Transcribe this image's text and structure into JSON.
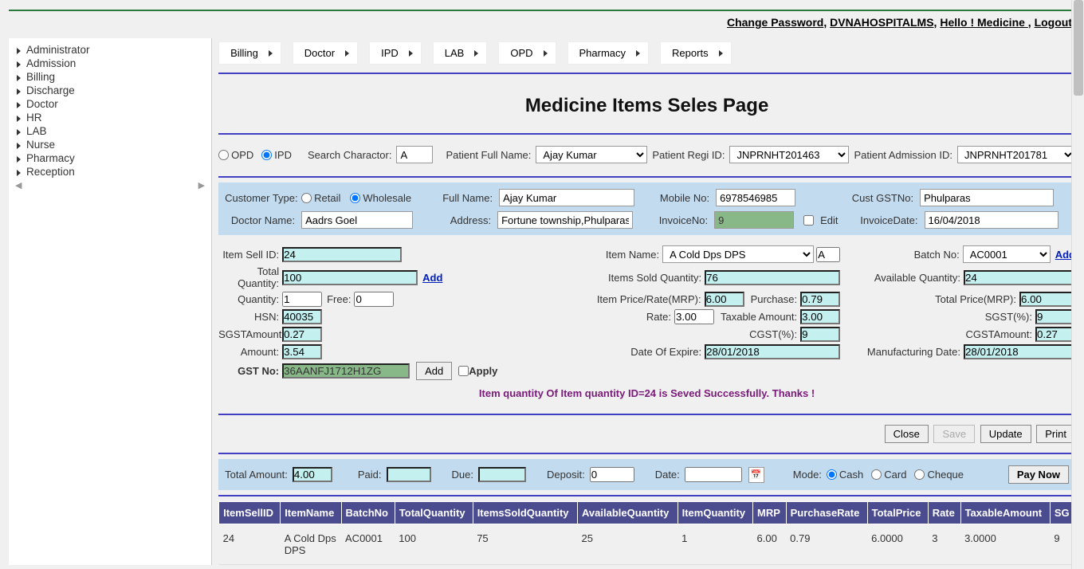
{
  "header": {
    "links": [
      "Change Password",
      "DVNAHOSPITALMS",
      "Hello ! Medicine ",
      "Logout"
    ]
  },
  "sidebar": {
    "items": [
      "Administrator",
      "Admission",
      "Billing",
      "Discharge",
      "Doctor",
      "HR",
      "LAB",
      "Nurse",
      "Pharmacy",
      "Reception"
    ]
  },
  "topmenu": {
    "items": [
      "Billing",
      "Doctor",
      "IPD",
      "LAB",
      "OPD",
      "Pharmacy",
      "Reports"
    ]
  },
  "page_title": "Medicine Items Seles Page",
  "search": {
    "opd_label": "OPD",
    "ipd_label": "IPD",
    "ipd_selected": true,
    "search_char_label": "Search Charactor:",
    "search_char": "A",
    "full_name_label": "Patient Full Name:",
    "full_name": "Ajay Kumar",
    "regi_label": "Patient Regi ID:",
    "regi_id": "JNPRNHT201463",
    "admission_label": "Patient Admission ID:",
    "admission_id": "JNPRNHT201781"
  },
  "customer": {
    "type_label": "Customer Type:",
    "retail": "Retail",
    "wholesale": "Wholesale",
    "wholesale_selected": true,
    "full_name_label": "Full Name:",
    "full_name": "Ajay Kumar",
    "mobile_label": "Mobile No:",
    "mobile": "6978546985",
    "cust_gst_label": "Cust GSTNo:",
    "cust_gst": "Phulparas",
    "doctor_label": "Doctor Name:",
    "doctor": "Aadrs Goel",
    "address_label": "Address:",
    "address": "Fortune township,Phulparas,",
    "invoice_no_label": "InvoiceNo:",
    "invoice_no": "9",
    "edit_label": "Edit",
    "invoice_date_label": "InvoiceDate:",
    "invoice_date": "16/04/2018"
  },
  "item": {
    "sell_id_label": "Item Sell ID:",
    "sell_id": "24",
    "item_name_label": "Item Name:",
    "item_name": "A Cold Dps DPS",
    "item_name_code": "A",
    "batch_label": "Batch No:",
    "batch": "AC0001",
    "add_label": "Add",
    "total_qty_label": "Total Quantity:",
    "total_qty": "100",
    "sold_qty_label": "Items Sold Quantity:",
    "sold_qty": "76",
    "avail_qty_label": "Available Quantity:",
    "avail_qty": "24",
    "qty_label": "Quantity:",
    "qty": "1",
    "free_label": "Free:",
    "free": "0",
    "mrp_label": "Item Price/Rate(MRP):",
    "mrp": "6.00",
    "purchase_label": "Purchase:",
    "purchase": "0.79",
    "total_price_label": "Total Price(MRP):",
    "total_price": "6.00",
    "hsn_label": "HSN:",
    "hsn": "40035",
    "rate_label": "Rate:",
    "rate": "3.00",
    "taxable_label": "Taxable Amount:",
    "taxable": "3.00",
    "sgst_pct_label": "SGST(%):",
    "sgst_pct": "9",
    "sgst_amt_label": "SGSTAmount:",
    "sgst_amt": "0.27",
    "cgst_pct_label": "CGST(%):",
    "cgst_pct": "9",
    "cgst_amt_label": "CGSTAmount:",
    "cgst_amt": "0.27",
    "amount_label": "Amount:",
    "amount": "3.54",
    "expire_label": "Date Of Expire:",
    "expire": "28/01/2018",
    "mfg_label": "Manufacturing Date:",
    "mfg": "28/01/2018",
    "gst_no_label": "GST No:",
    "gst_no": "36AANFJ1712H1ZG",
    "add_btn": "Add",
    "apply_label": "Apply"
  },
  "status_msg": "Item quantity Of Item quantity ID=24 is Seved Successfully. Thanks !",
  "buttons": {
    "close": "Close",
    "save": "Save",
    "update": "Update",
    "print": "Print"
  },
  "payment": {
    "total_label": "Total Amount:",
    "total": "4.00",
    "paid_label": "Paid:",
    "paid": "",
    "due_label": "Due:",
    "due": "",
    "deposit_label": "Deposit:",
    "deposit": "0",
    "date_label": "Date:",
    "date": "",
    "mode_label": "Mode:",
    "cash": "Cash",
    "card": "Card",
    "cheque": "Cheque",
    "paynow": "Pay Now"
  },
  "table": {
    "headers": [
      "ItemSellID",
      "ItemName",
      "BatchNo",
      "TotalQuantity",
      "ItemsSoldQuantity",
      "AvailableQuantity",
      "ItemQuantity",
      "MRP",
      "PurchaseRate",
      "TotalPrice",
      "Rate",
      "TaxableAmount",
      "SG"
    ],
    "rows": [
      {
        "c0": "24",
        "c1": "A Cold Dps DPS",
        "c2": "AC0001",
        "c3": "100",
        "c4": "75",
        "c5": "25",
        "c6": "1",
        "c7": "6.00",
        "c8": "0.79",
        "c9": "6.0000",
        "c10": "3",
        "c11": "3.0000",
        "c12": "9"
      }
    ]
  }
}
